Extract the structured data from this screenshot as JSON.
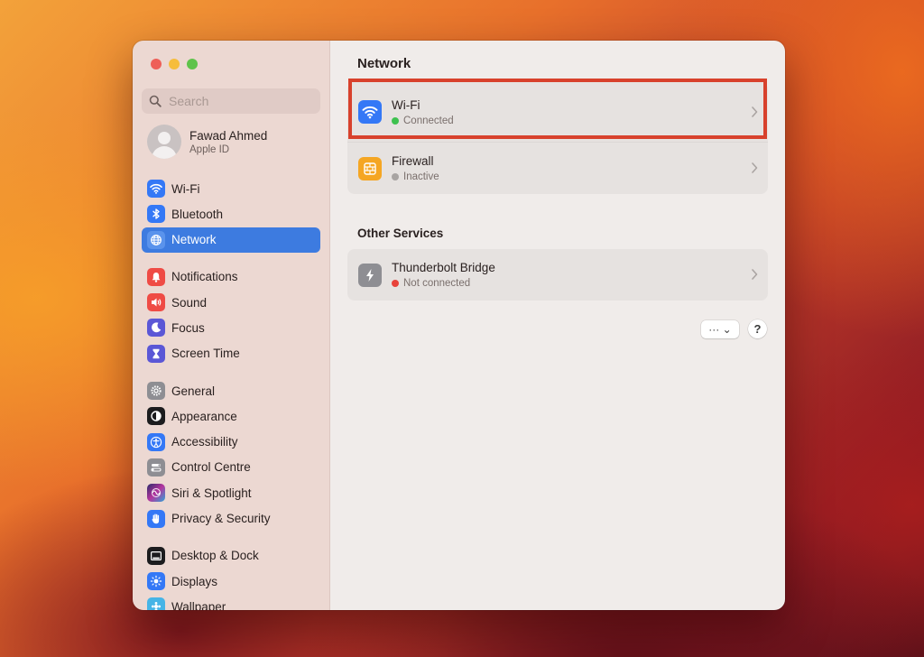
{
  "window": {
    "title": "Network"
  },
  "sidebar": {
    "search_placeholder": "Search",
    "profile": {
      "name": "Fawad Ahmed",
      "subtitle": "Apple ID"
    },
    "items": [
      {
        "label": "Wi-Fi",
        "icon": "wifi-icon",
        "color": "#3478f6"
      },
      {
        "label": "Bluetooth",
        "icon": "bluetooth-icon",
        "color": "#3478f6"
      },
      {
        "label": "Network",
        "icon": "globe-icon",
        "color": "#3478f6",
        "active": true
      },
      {
        "label": "Notifications",
        "icon": "bell-icon",
        "color": "#ef4b45"
      },
      {
        "label": "Sound",
        "icon": "speaker-icon",
        "color": "#ef4b45"
      },
      {
        "label": "Focus",
        "icon": "moon-icon",
        "color": "#5b57d6"
      },
      {
        "label": "Screen Time",
        "icon": "hourglass-icon",
        "color": "#5b57d6"
      },
      {
        "label": "General",
        "icon": "gear-icon",
        "color": "#8e8e93"
      },
      {
        "label": "Appearance",
        "icon": "appearance-icon",
        "color": "#1c1c1e"
      },
      {
        "label": "Accessibility",
        "icon": "accessibility-icon",
        "color": "#3478f6"
      },
      {
        "label": "Control Centre",
        "icon": "control-centre-icon",
        "color": "#8e8e93"
      },
      {
        "label": "Siri & Spotlight",
        "icon": "siri-icon",
        "color": "#b5359e"
      },
      {
        "label": "Privacy & Security",
        "icon": "hand-icon",
        "color": "#3478f6"
      },
      {
        "label": "Desktop & Dock",
        "icon": "dock-icon",
        "color": "#1c1c1e"
      },
      {
        "label": "Displays",
        "icon": "sun-icon",
        "color": "#3478f6"
      },
      {
        "label": "Wallpaper",
        "icon": "wallpaper-icon",
        "color": "#46b4e6"
      }
    ]
  },
  "main": {
    "services": [
      {
        "name": "Wi-Fi",
        "status": "Connected",
        "status_color": "#3ec14f",
        "icon_color": "#3478f6"
      },
      {
        "name": "Firewall",
        "status": "Inactive",
        "status_color": "#a8a4a2",
        "icon_color": "#f5a623"
      }
    ],
    "other_title": "Other Services",
    "other_services": [
      {
        "name": "Thunderbolt Bridge",
        "status": "Not connected",
        "status_color": "#e8423a",
        "icon_color": "#8e8e93"
      }
    ],
    "more_label": "··· ⌄",
    "help_label": "?"
  }
}
